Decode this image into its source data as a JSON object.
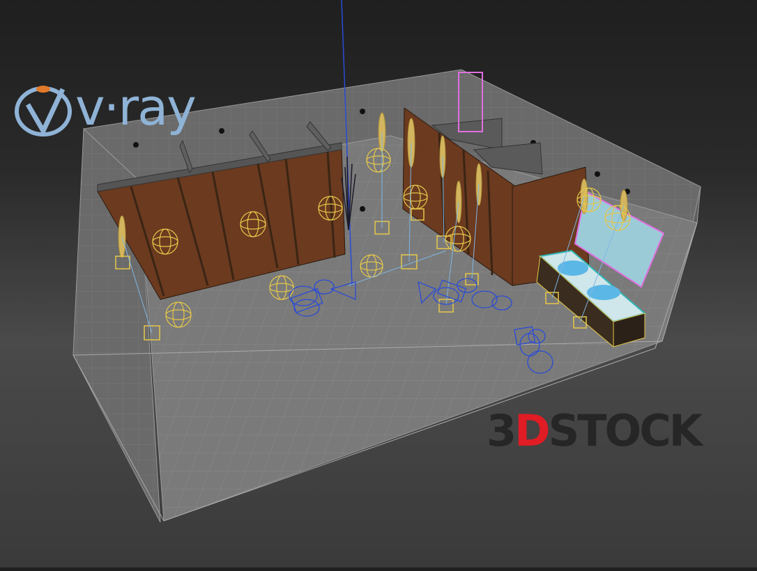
{
  "viewport": {
    "background_top": "#1f1f1f",
    "background_mid": "#4a4a4a"
  },
  "logos": {
    "vray_text": "v·ray",
    "vray_color": "#8fb3d6",
    "stock_prefix_digit": "3",
    "stock_prefix_letter": "D",
    "stock_word": "STOCK",
    "stock_red": "#e01c24",
    "stock_dark": "#262626"
  },
  "scene": {
    "wall_color": "#6b6b6b",
    "floor_color": "#7a7a7a",
    "door_color": "#6b3a1f",
    "light_color": "#e6c84a",
    "camera_color": "#2a4bd6",
    "mirror_frame_color": "#e070e0",
    "sink_color": "#cfe6ea",
    "icons": [
      "omni-light-icon",
      "spot-light-icon",
      "camera-icon",
      "target-box-icon"
    ]
  }
}
